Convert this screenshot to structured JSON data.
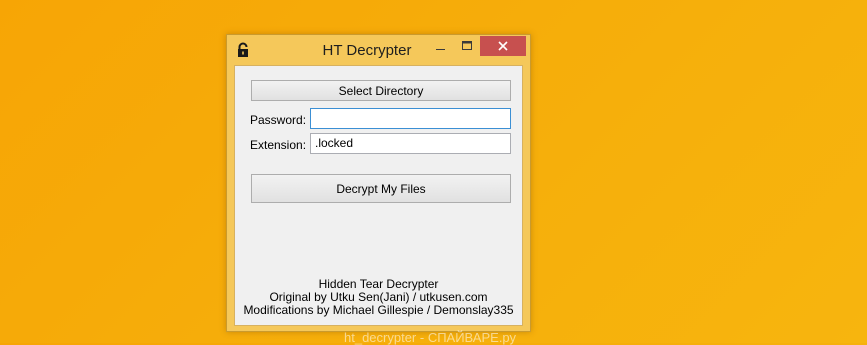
{
  "window": {
    "title": "HT Decrypter",
    "icons": {
      "app": "padlock-icon",
      "minimize": "minimize-icon",
      "maximize": "maximize-icon",
      "close": "close-icon"
    }
  },
  "form": {
    "select_directory_label": "Select Directory",
    "password_label": "Password:",
    "password_value": "",
    "extension_label": "Extension:",
    "extension_value": ".locked",
    "decrypt_label": "Decrypt My Files"
  },
  "credits": {
    "line1": "Hidden Tear Decrypter",
    "line2": "Original by Utku Sen(Jani) / utkusen.com",
    "line3": "Modifications by Michael Gillespie / Demonslay335"
  },
  "watermark": "ht_decrypter - СПАЙВАРЕ.ру",
  "colors": {
    "desktop": "#f7ac08",
    "titlebar": "#f5c85a",
    "close_button": "#c7504f",
    "client": "#f0f0f0",
    "focus_border": "#3b8fd4"
  }
}
